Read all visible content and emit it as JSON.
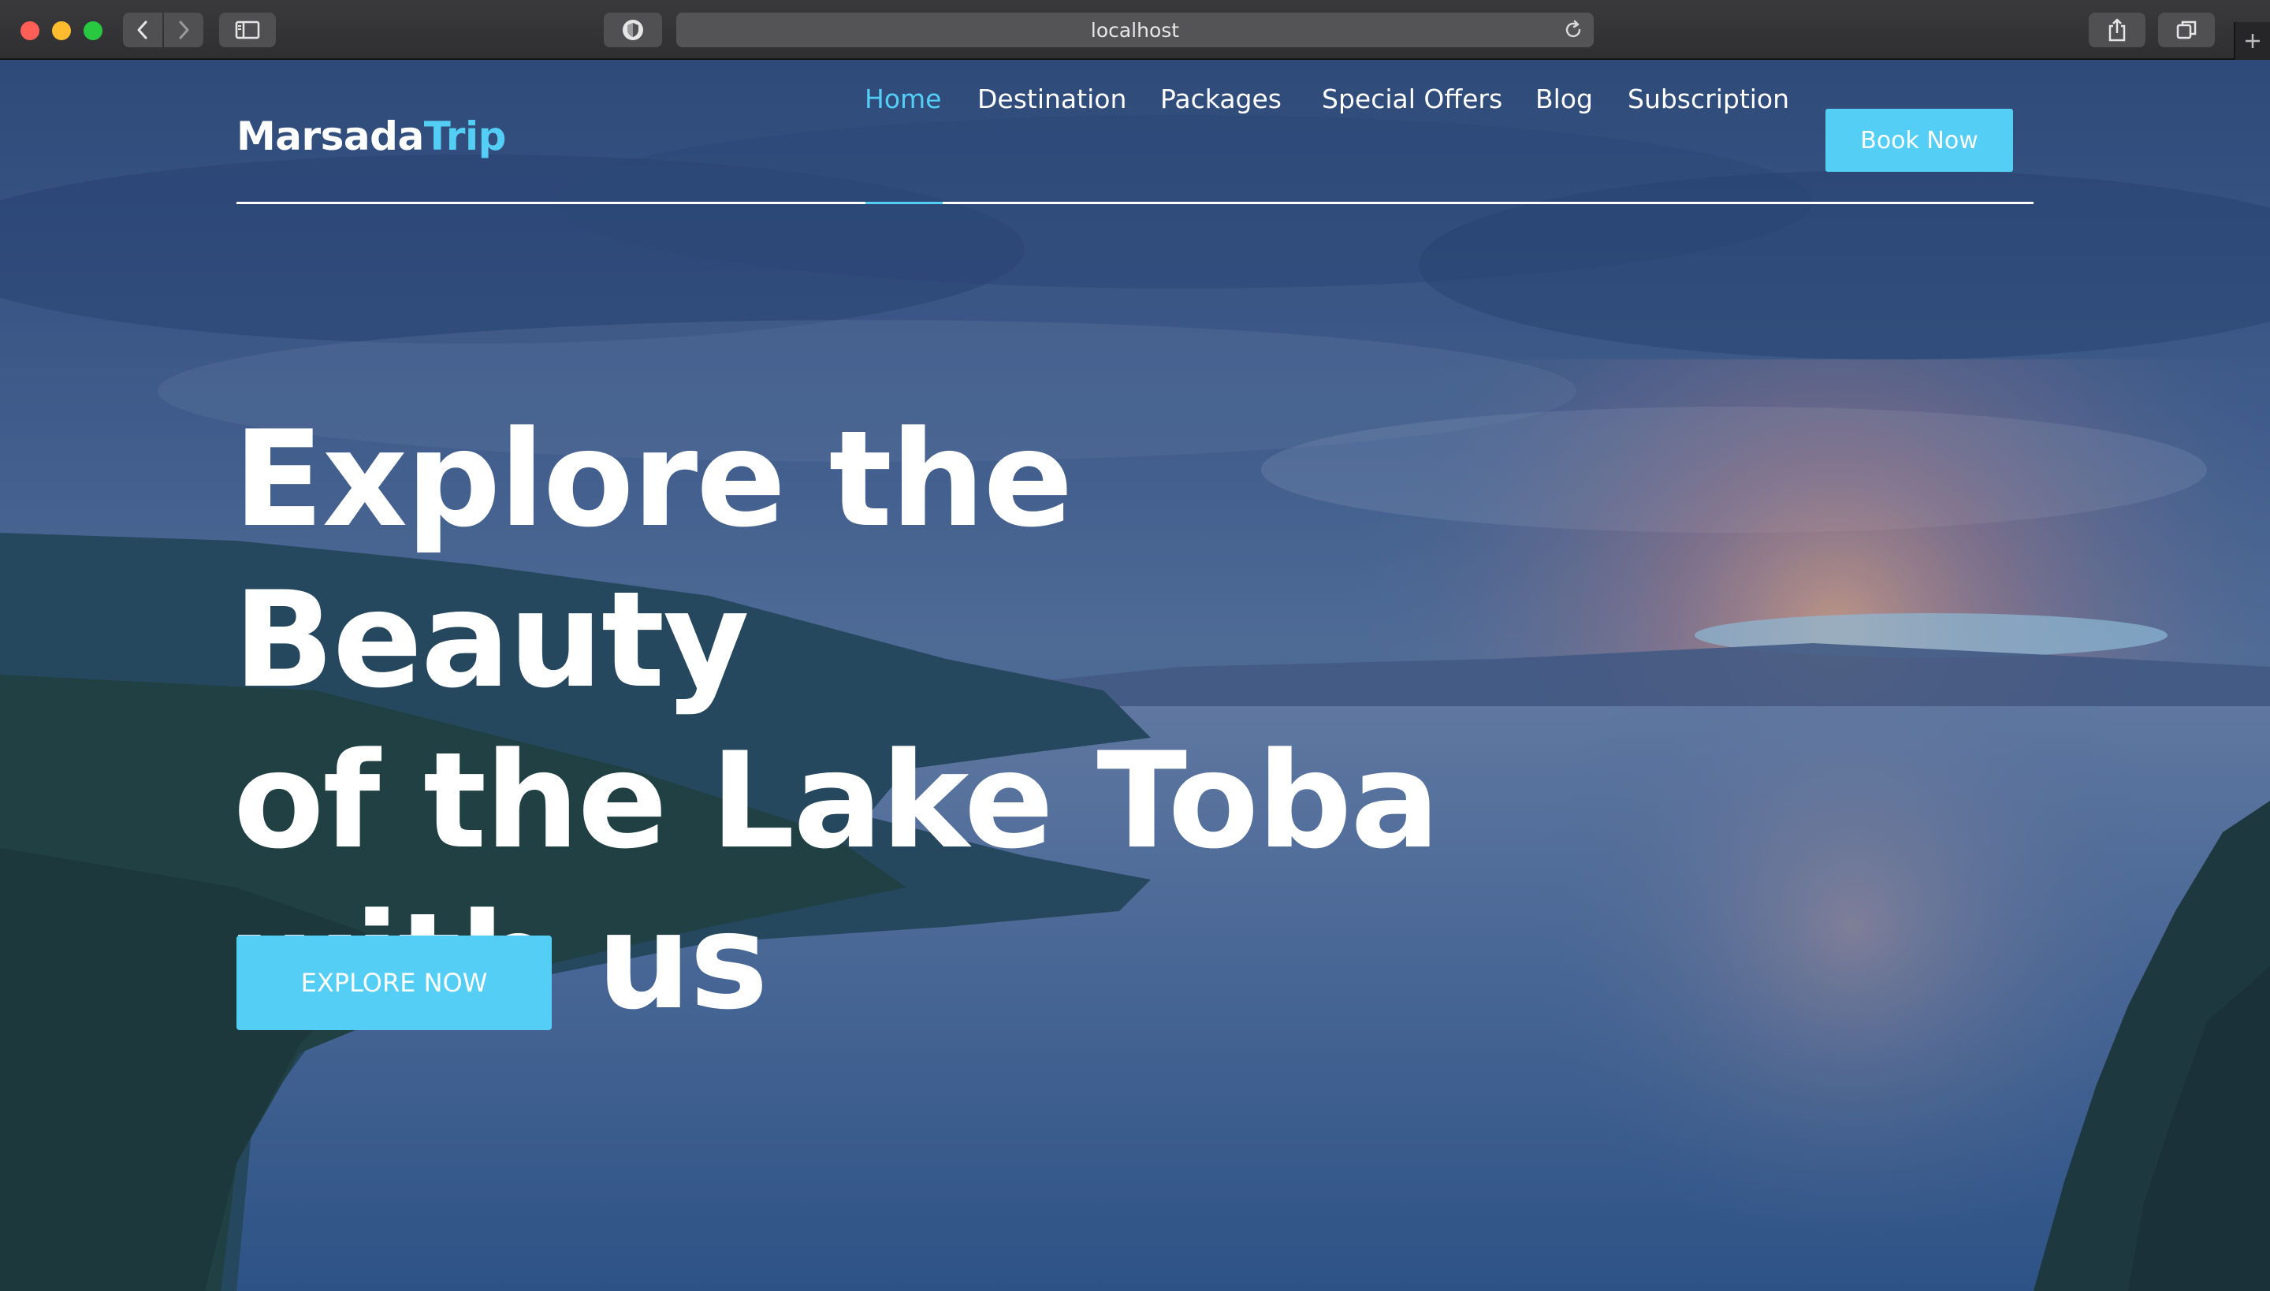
{
  "browser": {
    "url": "localhost",
    "icons": {
      "back": "chevron-left-icon",
      "forward": "chevron-right-icon",
      "sidebar": "sidebar-icon",
      "privacy": "shield-icon",
      "reload": "reload-icon",
      "share": "share-icon",
      "tabs": "tabs-overview-icon",
      "new_tab": "plus-icon"
    }
  },
  "site": {
    "logo_main": "Marsada",
    "logo_accent": "Trip",
    "nav": {
      "items": [
        {
          "label": "Home",
          "active": true
        },
        {
          "label": "Destination",
          "active": false
        },
        {
          "label": "Packages",
          "active": false
        },
        {
          "label": "Special Offers",
          "active": false
        },
        {
          "label": "Blog",
          "active": false
        },
        {
          "label": "Subscription",
          "active": false
        }
      ],
      "cta_label": "Book Now"
    },
    "hero": {
      "title_lines": [
        "Explore the Beauty",
        "of the Lake Toba",
        "with us"
      ],
      "cta_label": "EXPLORE NOW"
    }
  },
  "colors": {
    "accent": "#55cef5",
    "text": "#ffffff",
    "chrome": "#3a3a3c"
  }
}
